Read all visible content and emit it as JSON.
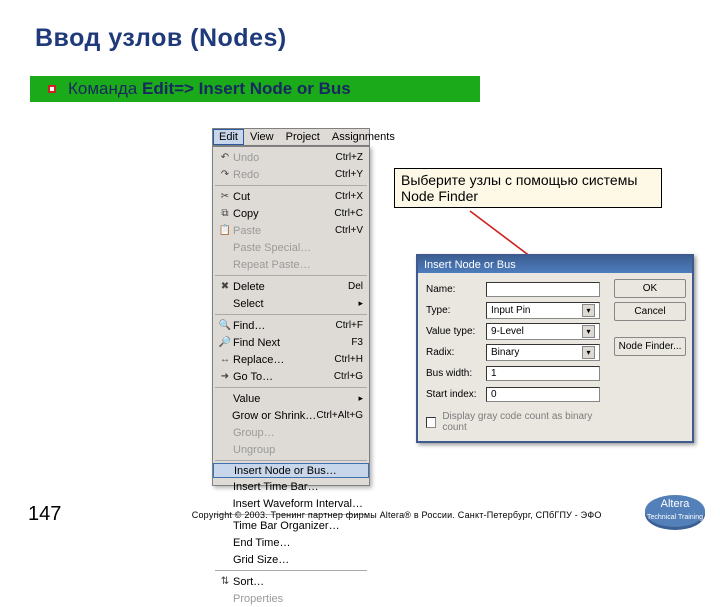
{
  "title": "Ввод узлов  (Nodes)",
  "subtitle": {
    "prefix": "Команда ",
    "bold": "Edit=> Insert Node or Bus"
  },
  "menubar": [
    "Edit",
    "View",
    "Project",
    "Assignments"
  ],
  "menu_items": [
    {
      "icon": "↶",
      "label": "Undo",
      "sc": "Ctrl+Z",
      "dim": true
    },
    {
      "icon": "↷",
      "label": "Redo",
      "sc": "Ctrl+Y",
      "dim": true
    },
    {
      "sep": true
    },
    {
      "icon": "✂",
      "label": "Cut",
      "sc": "Ctrl+X"
    },
    {
      "icon": "⧉",
      "label": "Copy",
      "sc": "Ctrl+C"
    },
    {
      "icon": "📋",
      "label": "Paste",
      "sc": "Ctrl+V",
      "dim": true
    },
    {
      "icon": "",
      "label": "Paste Special…",
      "sc": "",
      "dim": true
    },
    {
      "icon": "",
      "label": "Repeat Paste…",
      "sc": "",
      "dim": true
    },
    {
      "sep": true
    },
    {
      "icon": "✖",
      "label": "Delete",
      "sc": "Del"
    },
    {
      "icon": "",
      "label": "Select",
      "sc": "",
      "sub": true
    },
    {
      "sep": true
    },
    {
      "icon": "🔍",
      "label": "Find…",
      "sc": "Ctrl+F"
    },
    {
      "icon": "🔎",
      "label": "Find Next",
      "sc": "F3"
    },
    {
      "icon": "↔",
      "label": "Replace…",
      "sc": "Ctrl+H"
    },
    {
      "icon": "➜",
      "label": "Go To…",
      "sc": "Ctrl+G"
    },
    {
      "sep": true
    },
    {
      "icon": "",
      "label": "Value",
      "sc": "",
      "sub": true
    },
    {
      "icon": "",
      "label": "Grow or Shrink…",
      "sc": "Ctrl+Alt+G"
    },
    {
      "icon": "",
      "label": "Group…",
      "sc": "",
      "dim": true
    },
    {
      "icon": "",
      "label": "Ungroup",
      "sc": "",
      "dim": true
    },
    {
      "sep": true
    },
    {
      "icon": "",
      "label": "Insert Node or Bus…",
      "sc": "",
      "sel": true
    },
    {
      "icon": "",
      "label": "Insert Time Bar…",
      "sc": ""
    },
    {
      "icon": "",
      "label": "Insert Waveform Interval…",
      "sc": ""
    },
    {
      "sep": true
    },
    {
      "icon": "",
      "label": "Time Bar Organizer…",
      "sc": ""
    },
    {
      "icon": "",
      "label": "End Time…",
      "sc": ""
    },
    {
      "icon": "",
      "label": "Grid Size…",
      "sc": ""
    },
    {
      "sep": true
    },
    {
      "icon": "⇅",
      "label": "Sort…",
      "sc": ""
    },
    {
      "icon": "",
      "label": "Properties",
      "sc": "",
      "dim": true
    }
  ],
  "callout": "Выберите узлы с помощью системы Node Finder",
  "dialog": {
    "title": "Insert Node or Bus",
    "fields": {
      "name_label": "Name:",
      "type_label": "Type:",
      "value_type_label": "Value type:",
      "radix_label": "Radix:",
      "bus_width_label": "Bus width:",
      "start_index_label": "Start index:",
      "name_value": "",
      "type_value": "Input Pin",
      "value_type_value": "9-Level",
      "radix_value": "Binary",
      "bus_width_value": "1",
      "start_index_value": "0"
    },
    "buttons": {
      "ok": "OK",
      "cancel": "Cancel",
      "node_finder": "Node Finder..."
    },
    "checkbox": "Display gray code count as binary count"
  },
  "footer": {
    "page": "147",
    "text": "Copyright © 2003. Тренинг партнер фирмы Altera®   в России. Санкт-Петербург, СПбГПУ - ЭФО",
    "logo_top": "Altera",
    "logo_bottom": "Technical Training"
  }
}
